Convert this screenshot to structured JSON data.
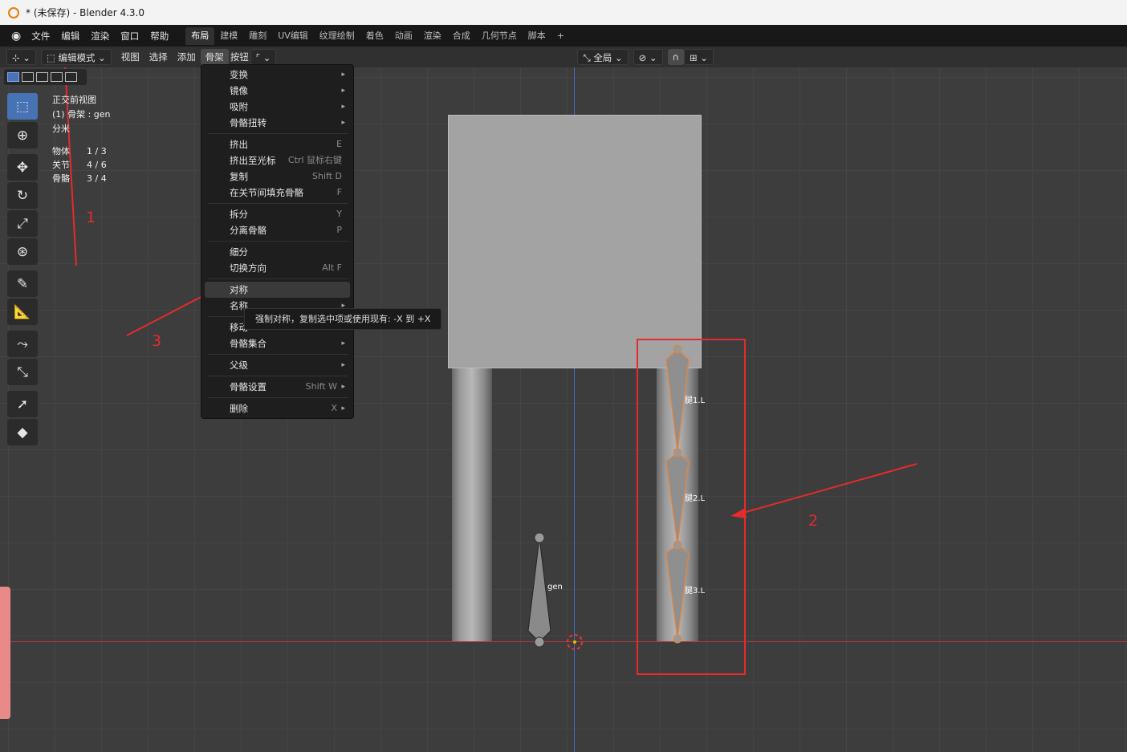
{
  "titlebar": {
    "title": "* (未保存) - Blender 4.3.0"
  },
  "menu": {
    "items": [
      "文件",
      "编辑",
      "渲染",
      "窗口",
      "帮助"
    ]
  },
  "workspaces": [
    "布局",
    "建模",
    "雕刻",
    "UV编辑",
    "纹理绘制",
    "着色",
    "动画",
    "渲染",
    "合成",
    "几何节点",
    "脚本",
    "+"
  ],
  "header": {
    "mode": "编辑模式",
    "menus": [
      "视图",
      "选择",
      "添加",
      "骨架",
      "按钮"
    ],
    "orientation": "全局"
  },
  "overlay": {
    "view_name": "正交前视图",
    "object_info": "(1) 骨架 : gen",
    "unit": "分米",
    "stats": [
      {
        "label": "物体",
        "value": "1 / 3"
      },
      {
        "label": "关节",
        "value": "4 / 6"
      },
      {
        "label": "骨骼",
        "value": "3 / 4"
      }
    ]
  },
  "armature_menu": {
    "items": [
      {
        "label": "变换",
        "shortcut": "",
        "submenu": true
      },
      {
        "label": "镜像",
        "shortcut": "",
        "submenu": true
      },
      {
        "label": "吸附",
        "shortcut": "",
        "submenu": true
      },
      {
        "label": "骨骼扭转",
        "shortcut": "",
        "submenu": true
      },
      {
        "sep": true
      },
      {
        "label": "挤出",
        "shortcut": "E",
        "submenu": false
      },
      {
        "label": "挤出至光标",
        "shortcut": "Ctrl 鼠标右键",
        "submenu": false
      },
      {
        "label": "复制",
        "shortcut": "Shift D",
        "submenu": false
      },
      {
        "label": "在关节间填充骨骼",
        "shortcut": "F",
        "submenu": false
      },
      {
        "sep": true
      },
      {
        "label": "拆分",
        "shortcut": "Y",
        "submenu": false
      },
      {
        "label": "分离骨骼",
        "shortcut": "P",
        "submenu": false
      },
      {
        "sep": true
      },
      {
        "label": "细分",
        "shortcut": "",
        "submenu": false
      },
      {
        "label": "切换方向",
        "shortcut": "Alt F",
        "submenu": false
      },
      {
        "sep": true
      },
      {
        "label": "对称",
        "shortcut": "",
        "submenu": false,
        "highlight": true
      },
      {
        "label": "名称",
        "shortcut": "",
        "submenu": true
      },
      {
        "sep": true
      },
      {
        "label": "移动",
        "shortcut": "",
        "submenu": false
      },
      {
        "label": "骨骼集合",
        "shortcut": "",
        "submenu": true
      },
      {
        "sep": true
      },
      {
        "label": "父级",
        "shortcut": "",
        "submenu": true
      },
      {
        "sep": true
      },
      {
        "label": "骨骼设置",
        "shortcut": "Shift W",
        "submenu": true
      },
      {
        "sep": true
      },
      {
        "label": "删除",
        "shortcut": "X",
        "submenu": true
      }
    ]
  },
  "tooltip": {
    "text": "强制对称，复制选中项或使用现有: -X 到 +X"
  },
  "bones": {
    "labels": [
      "腿1.L",
      "腿2.L",
      "腿3.L",
      "gen"
    ]
  },
  "annotations": {
    "labels": [
      "1",
      "2",
      "3"
    ]
  },
  "colors": {
    "accent": "#4772b3",
    "annotation": "#e52b2b",
    "bone_select": "#e8843a"
  }
}
